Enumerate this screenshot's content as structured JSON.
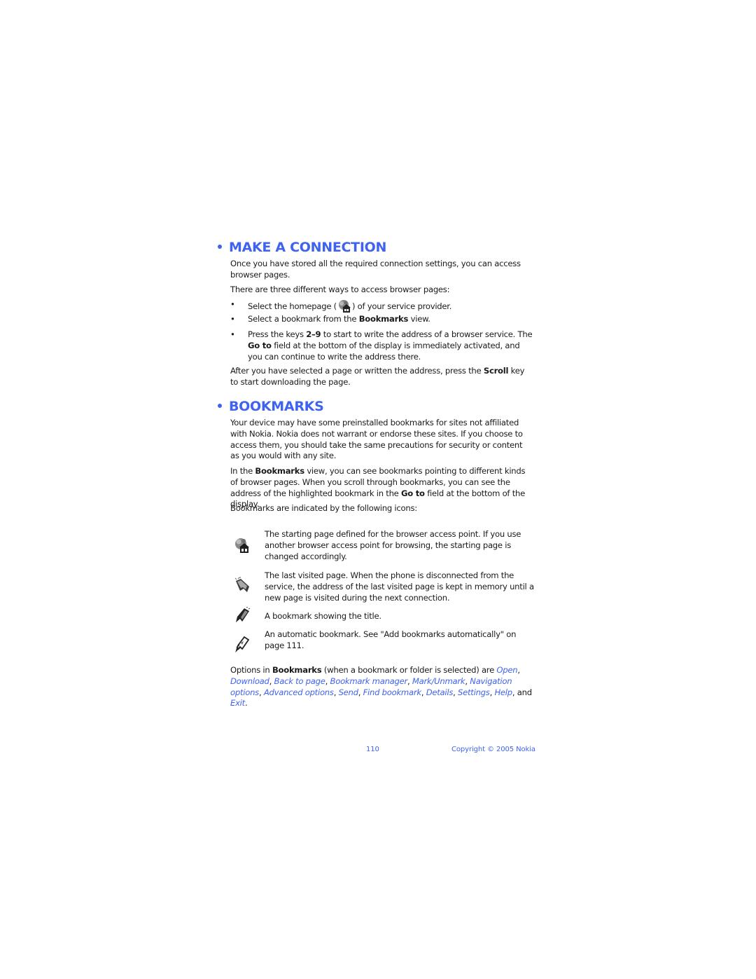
{
  "sections": [
    {
      "heading": "MAKE A CONNECTION",
      "intro": "Once you have stored all the required connection settings, you can access browser pages.",
      "ways_intro": "There are three different ways to access browser pages:",
      "bullets": [
        {
          "before": "Select the homepage (",
          "icon": "homepage-icon",
          "after": ") of your service provider."
        },
        {
          "before": "Select a bookmark from the ",
          "bold": "Bookmarks",
          "after": " view."
        },
        {
          "before": "Press the keys ",
          "bold1": "2–9",
          "middle": " to start to write the address of a browser service. The ",
          "bold2": "Go to",
          "after": " field at the bottom of the display is immediately activated, and you can continue to write the address there."
        }
      ],
      "closing": {
        "before": "After you have selected a page or written the address, press the ",
        "bold": "Scroll",
        "after": " key to start downloading the page."
      }
    },
    {
      "heading": "BOOKMARKS",
      "disclaimer": "Your device may have some preinstalled bookmarks for sites not affiliated with Nokia. Nokia does not warrant or endorse these sites. If you choose to access them, you should take the same precautions for security or content as you would with any site.",
      "view_para": {
        "p1": "In the ",
        "b1": "Bookmarks",
        "p2": " view, you can see bookmarks pointing to different kinds of browser pages. When you scroll through bookmarks, you can see the address of the highlighted bookmark in the ",
        "b2": "Go to",
        "p3": " field at the bottom of the display."
      },
      "icons_intro": "Bookmarks are indicated by the following icons:",
      "icon_list": [
        {
          "icon": "starting-page-icon",
          "text": "The starting page defined for the browser access point. If you use another browser access point for browsing, the starting page is changed accordingly."
        },
        {
          "icon": "last-visited-page-icon",
          "text": "The last visited page. When the phone is disconnected from the service, the address of the last visited page is kept in memory until a new page is visited during the next connection."
        },
        {
          "icon": "bookmark-title-icon",
          "text": "A bookmark showing the title."
        },
        {
          "icon": "automatic-bookmark-icon",
          "text": "An automatic bookmark. See \"Add bookmarks automatically\" on page 111."
        }
      ],
      "options": {
        "prefix": "Options in ",
        "bold": "Bookmarks",
        "middle": " (when a bookmark or folder is selected) are ",
        "items": [
          "Open",
          "Download",
          "Back to page",
          "Bookmark manager",
          "Mark/Unmark",
          "Navigation options",
          "Advanced options",
          "Send",
          "Find bookmark",
          "Details",
          "Settings",
          "Help",
          "Exit"
        ],
        "and_word": "and",
        "end": "."
      }
    }
  ],
  "footer": {
    "page_number": "110",
    "copyright": "Copyright © 2005 Nokia"
  },
  "colors": {
    "accent": "#3f63f0",
    "text": "#1a1a1a"
  }
}
